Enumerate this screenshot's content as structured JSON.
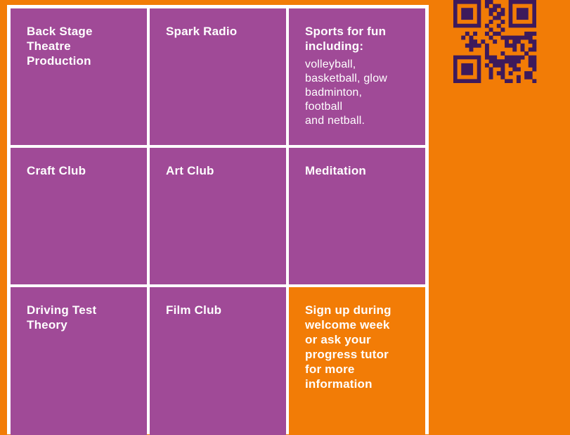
{
  "cells": [
    {
      "title": "Back Stage\nTheatre\nProduction"
    },
    {
      "title": "Spark Radio"
    },
    {
      "title": "Sports for fun\nincluding:",
      "body": "volleyball,\nbasketball, glow\nbadminton,\nfootball\nand netball."
    },
    {
      "title": "Craft Club"
    },
    {
      "title": "Art Club"
    },
    {
      "title": "Meditation"
    },
    {
      "title": "Driving Test\nTheory"
    },
    {
      "title": "Film Club"
    },
    {
      "title": "Sign up during\nwelcome week\nor ask your\nprogress tutor\nfor more\ninformation"
    }
  ],
  "colors": {
    "background": "#f27c06",
    "cell": "#a04a97",
    "grid_lines": "#ffffff",
    "qr": "#3d1a5c"
  },
  "qr_code": {
    "icon": "qr-code-icon"
  }
}
